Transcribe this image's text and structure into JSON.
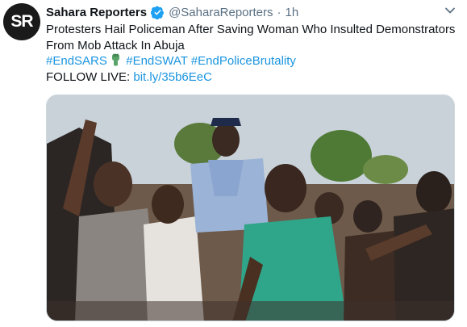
{
  "account": {
    "avatar_text": "SR",
    "display_name": "Sahara Reporters",
    "handle": "@SaharaReporters",
    "separator": "·",
    "time": "1h",
    "verified_icon": "verified-badge-icon",
    "colors": {
      "verified": "#1da1f2",
      "link": "#1b95e0",
      "secondary": "#5b7083"
    }
  },
  "tweet": {
    "text_line1": "Protesters Hail Policeman After Saving Woman Who Insulted Demonstrators",
    "text_line2": "From Mob Attack In Abuja",
    "hashtags": [
      "#EndSARS",
      "#EndSWAT",
      "#EndPoliceBrutality"
    ],
    "follow_label": "FOLLOW LIVE:",
    "follow_link": "bit.ly/35b6EeC",
    "emoji_icon": "raised-fist-icon"
  },
  "media": {
    "kind": "video-still",
    "icon": "video-media"
  },
  "menu": {
    "icon": "chevron-down-icon"
  }
}
